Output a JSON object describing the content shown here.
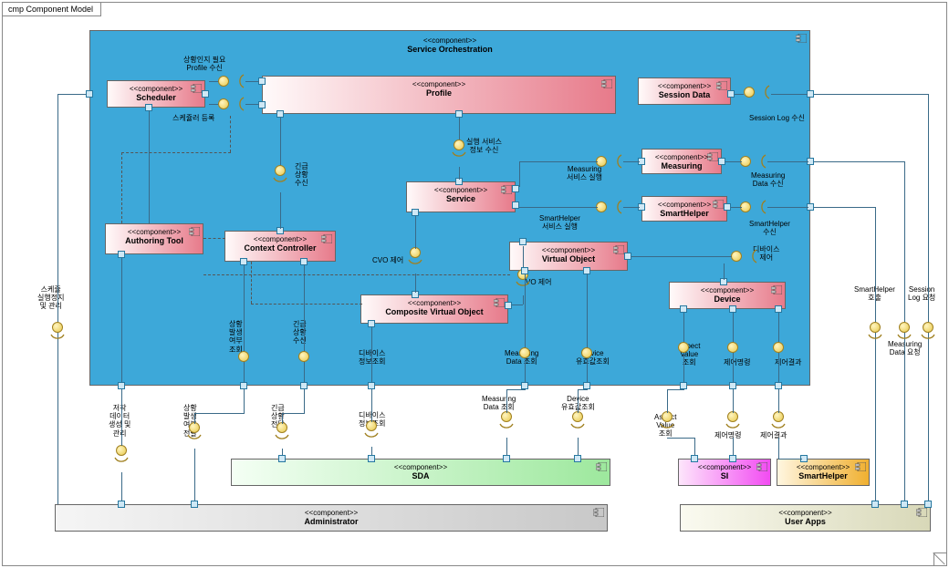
{
  "frame_label": "cmp Component Model",
  "stereo": "<<component>>",
  "main": {
    "name": "Service Orchestration"
  },
  "c": {
    "scheduler": "Scheduler",
    "profile": "Profile",
    "session_data": "Session Data",
    "authoring": "Authoring Tool",
    "context": "Context Controller",
    "service": "Service",
    "measuring": "Measuring",
    "smarthelper_c": "SmartHelper",
    "virtual_obj": "Virtual Object",
    "cvo": "Composite Virtual Object",
    "device": "Device",
    "sda": "SDA",
    "si": "SI",
    "smarthelper_b": "SmartHelper",
    "admin": "Administrator",
    "userapps": "User Apps"
  },
  "l": {
    "l1": "상황인지 필요\nProfile 수신",
    "l2": "스케쥴러 등록",
    "l3": "Session Log 수신",
    "l4": "실행 서비스\n정보 수신",
    "l5": "긴급\n상황\n수신",
    "l6": "Measuring\n서비스 실행",
    "l7": "Measuring\nData 수신",
    "l8": "SmartHelper\n서비스 실행",
    "l9": "SmartHelper\n수신",
    "l10": "CVO 제어",
    "l11": "VO 제어",
    "l12": "디바이스\n제어",
    "l13": "SmartHelper\n호출",
    "l14": "Session\nLog 요청",
    "l15": "Measuring\nData 요청",
    "l16": "상황\n발생\n여부\n조회",
    "l17": "긴급\n상황\n수신",
    "l18": "디바이스\n정보조회",
    "l19": "Measuring\nData 조회",
    "l20": "Device\n유효값조회",
    "l21": "Aspect\nValue\n조회",
    "l22": "제어명령",
    "l23": "제어결과",
    "l24": "스케쥴\n실행정지\n및 관리",
    "l25": "저작\n데이터\n생성 및\n관리",
    "l26": "상황\n발생\n여부\n전달",
    "l27": "긴급\n상황\n전달",
    "l28": "디바이스\n정보조회",
    "l29": "Measuring\nData 조회",
    "l30": "Device\n유효값조회",
    "l31": "Aspect\nValue\n조회",
    "l32": "제어명령",
    "l33": "제어결과"
  }
}
